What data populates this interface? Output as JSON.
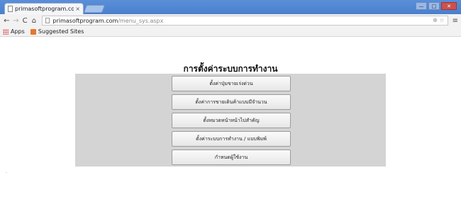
{
  "browser": {
    "tab_title": "primasoftprogram.co",
    "tab_close": "×",
    "url_host": "primasoftprogram.com",
    "url_path": "/menu_sys.aspx",
    "nav": {
      "back": "←",
      "forward": "→",
      "reload": "C",
      "home": "⌂"
    },
    "url_right_icons": "⊕ ☆",
    "menu": "≡",
    "window_controls": [
      "—",
      "□",
      "✕"
    ]
  },
  "bookmarks": [
    {
      "label": "Apps"
    },
    {
      "label": "Suggested Sites"
    }
  ],
  "page": {
    "title": "การตั้งค่าระบบการทำงาน",
    "menu_items": [
      {
        "label": "ตั้งค่าปุ่มขายเร่งด่วน"
      },
      {
        "label": "ตั้งค่าการขายเดินค้าแบบมีจำนวน"
      },
      {
        "label": "ตั้งหมวดหน้าหน้าไปสำคัญ"
      },
      {
        "label": "ตั้งค่าระบบการทำงาน / แบบพิมพ์"
      },
      {
        "label": "กำหนดผู้ใช้งาน"
      }
    ]
  }
}
